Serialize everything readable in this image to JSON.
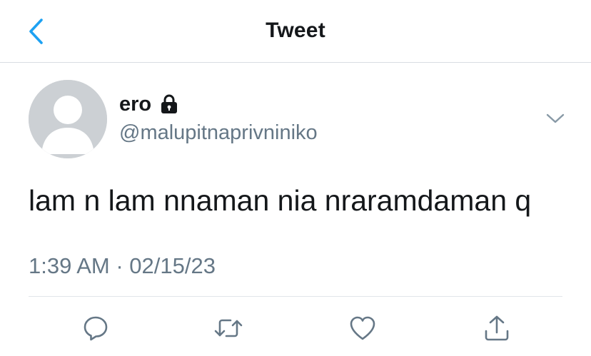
{
  "header": {
    "title": "Tweet",
    "back_icon": "chevron-left-icon",
    "accent_color": "#1da1f2"
  },
  "tweet": {
    "display_name": "ero",
    "protected_icon": "lock-icon",
    "handle": "@malupitnaprivniniko",
    "text": "lam n lam nnaman nia nraramdaman q",
    "timestamp": "1:39 AM · 02/15/23",
    "menu_icon": "chevron-down-icon",
    "avatar": "default-avatar"
  },
  "actions": [
    {
      "name": "reply",
      "icon": "reply-icon"
    },
    {
      "name": "retweet",
      "icon": "retweet-icon"
    },
    {
      "name": "like",
      "icon": "heart-icon"
    },
    {
      "name": "share",
      "icon": "share-icon"
    }
  ],
  "colors": {
    "text": "#14171a",
    "secondary": "#657786",
    "divider": "#e1e5e9",
    "icon": "#657786"
  }
}
